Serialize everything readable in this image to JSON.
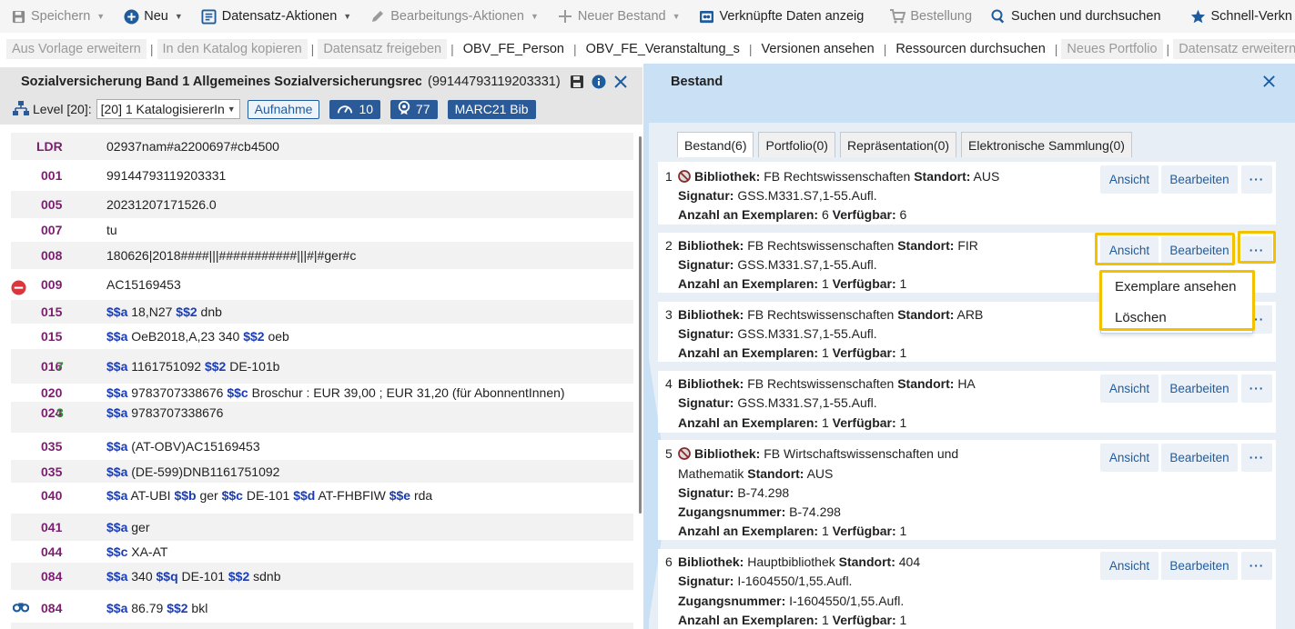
{
  "toolbar": {
    "save": "Speichern",
    "new": "Neu",
    "record_actions": "Datensatz-Aktionen",
    "edit_actions": "Bearbeitungs-Aktionen",
    "new_holding": "Neuer Bestand",
    "linked_data": "Verknüpfte Daten anzeig",
    "order": "Bestellung",
    "search": "Suchen und durchsuchen",
    "quick": "Schnell-Verkn"
  },
  "actions": {
    "a1": "Aus Vorlage erweitern",
    "a2": "In den Katalog kopieren",
    "a3": "Datensatz freigeben",
    "a4": "OBV_FE_Person",
    "a5": "OBV_FE_Veranstaltung_s",
    "a6": "Versionen ansehen",
    "a7": "Ressourcen durchsuchen",
    "a8": "Neues Portfolio",
    "a9": "Datensatz erweitern",
    "separator": "|"
  },
  "record": {
    "title": "Sozialversicherung Band 1 Allgemeines Sozialversicherungsrec...",
    "id": "(99144793119203331)",
    "level_label": "Level [20]:",
    "level_value": "[20] 1 KatalogisiererIn",
    "aufnahme": "Aufnahme",
    "badge1": "10",
    "badge2": "77",
    "badge3": "MARC21 Bib"
  },
  "marc": {
    "ldr": {
      "tag": "LDR",
      "value": "02937nam#a2200697#cb4500"
    },
    "f001": {
      "tag": "001",
      "value": "99144793119203331"
    },
    "f005": {
      "tag": "005",
      "value": "20231207171526.0"
    },
    "f007": {
      "tag": "007",
      "value": "tu"
    },
    "f008": {
      "tag": "008",
      "value": "180626|2018####|||###########|||#|#ger#c"
    },
    "f009": {
      "tag": "009",
      "value": "AC15169453"
    },
    "f015a": {
      "tag": "015",
      "s1": "$$a",
      "v1": " 18,N27 ",
      "s2": "$$2",
      "v2": " dnb"
    },
    "f015b": {
      "tag": "015",
      "s1": "$$a",
      "v1": " OeB2018,A,23 340 ",
      "s2": "$$2",
      "v2": " oeb"
    },
    "f016": {
      "tag": "016",
      "ind": "7",
      "s1": "$$a",
      "v1": " 1161751092 ",
      "s2": "$$2",
      "v2": " DE-101b"
    },
    "f020": {
      "tag": "020",
      "s1": "$$a",
      "v1": " 9783707338676 ",
      "s2": "$$c",
      "v2": " Broschur : EUR 39,00 ; EUR 31,20 (für AbonnentInnen)"
    },
    "f024": {
      "tag": "024",
      "ind": "3",
      "s1": "$$a",
      "v1": " 9783707338676"
    },
    "f035a": {
      "tag": "035",
      "s1": "$$a",
      "v1": " (AT-OBV)AC15169453"
    },
    "f035b": {
      "tag": "035",
      "s1": "$$a",
      "v1": " (DE-599)DNB1161751092"
    },
    "f040": {
      "tag": "040",
      "s1": "$$a",
      "v1": " AT-UBI ",
      "s2": "$$b",
      "v2": " ger ",
      "s3": "$$c",
      "v3": " DE-101 ",
      "s4": "$$d",
      "v4": " AT-FHBFIW ",
      "s5": "$$e",
      "v5": " rda"
    },
    "f041": {
      "tag": "041",
      "s1": "$$a",
      "v1": " ger"
    },
    "f044": {
      "tag": "044",
      "s1": "$$c",
      "v1": " XA-AT"
    },
    "f084a": {
      "tag": "084",
      "s1": "$$a",
      "v1": " 340 ",
      "s2": "$$q",
      "v2": " DE-101 ",
      "s3": "$$2",
      "v3": " sdnb"
    },
    "f084b": {
      "tag": "084",
      "s1": "$$a",
      "v1": " 86.79 ",
      "s2": "$$2",
      "v2": " bkl"
    }
  },
  "panel": {
    "title": "Bestand",
    "tabs": [
      "Bestand(6)",
      "Portfolio(0)",
      "Repräsentation(0)",
      "Elektronische Sammlung(0)"
    ]
  },
  "labels": {
    "library": "Bibliothek:",
    "location": "Standort:",
    "callnumber": "Signatur:",
    "copies": "Anzahl an Exemplaren:",
    "available": "Verfügbar:",
    "accession": "Zugangsnummer:",
    "view": "Ansicht",
    "edit": "Bearbeiten",
    "more": "···"
  },
  "holdings": [
    {
      "num": "1",
      "library": "FB Rechtswissenschaften",
      "location": "AUS",
      "callnumber": "GSS.M331.S7,1-55.Aufl.",
      "copies": "6",
      "available": "6"
    },
    {
      "num": "2",
      "library": "FB Rechtswissenschaften",
      "location": "FIR",
      "callnumber": "GSS.M331.S7,1-55.Aufl.",
      "copies": "1",
      "available": "1"
    },
    {
      "num": "3",
      "library": "FB Rechtswissenschaften",
      "location": "ARB",
      "callnumber": "GSS.M331.S7,1-55.Aufl.",
      "copies": "1",
      "available": "1"
    },
    {
      "num": "4",
      "library": "FB Rechtswissenschaften",
      "location": "HA",
      "callnumber": "GSS.M331.S7,1-55.Aufl.",
      "copies": "1",
      "available": "1"
    },
    {
      "num": "5",
      "library_part1": "FB Wirtschaftswissenschaften und",
      "library_part2": "Mathematik",
      "location": "AUS",
      "callnumber": "B-74.298",
      "accession": "B-74.298",
      "copies": "1",
      "available": "1"
    },
    {
      "num": "6",
      "library": "Hauptbibliothek",
      "location": "404",
      "callnumber": "I-1604550/1,55.Aufl.",
      "accession": "I-1604550/1,55.Aufl.",
      "copies": "1",
      "available": "1"
    }
  ],
  "menu": {
    "item1": "Exemplare ansehen",
    "item2": "Löschen"
  },
  "colors": {
    "accent": "#1f5c9e",
    "highlight": "#f2c200",
    "tag": "#7a1f6f",
    "subfield": "#1a3db5"
  }
}
